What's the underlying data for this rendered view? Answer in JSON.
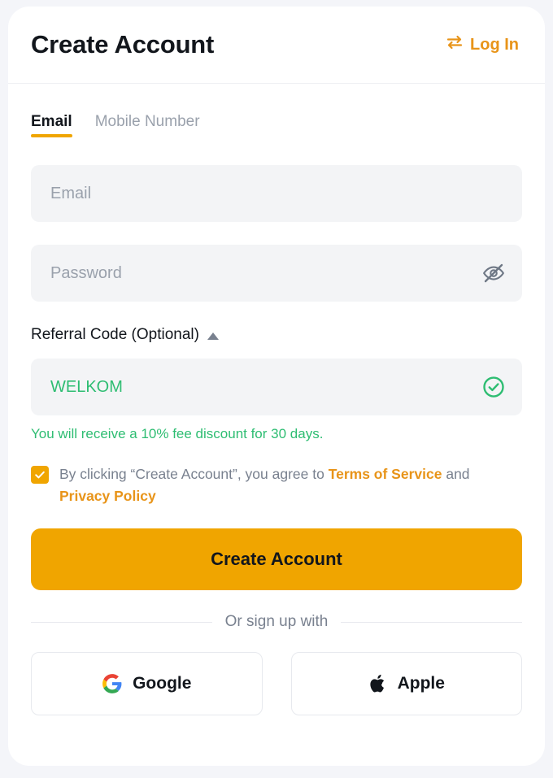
{
  "header": {
    "title": "Create Account",
    "login_label": "Log In",
    "login_icon": "swap-icon",
    "accent_color": "#e89419"
  },
  "tabs": [
    {
      "label": "Email",
      "active": true
    },
    {
      "label": "Mobile Number",
      "active": false
    }
  ],
  "form": {
    "email": {
      "value": "",
      "placeholder": "Email"
    },
    "password": {
      "value": "",
      "placeholder": "Password",
      "toggle_icon": "eye-off-icon"
    },
    "referral": {
      "label": "Referral Code (Optional)",
      "toggle_icon": "caret-up-icon",
      "value": "WELKOM",
      "placeholder": "Referral Code",
      "status_icon": "check-circle-icon",
      "helper_text": "You will receive a 10% fee discount for 30 days.",
      "valid_color": "#2ebd72"
    },
    "terms": {
      "checked": true,
      "prefix": "By clicking “Create Account”, you agree to ",
      "terms_link": "Terms of Service",
      "middle": " and ",
      "privacy_link": "Privacy Policy"
    },
    "submit_label": "Create Account",
    "submit_color": "#f0a500"
  },
  "divider_label": "Or sign up with",
  "social": [
    {
      "label": "Google",
      "icon": "google-icon"
    },
    {
      "label": "Apple",
      "icon": "apple-icon"
    }
  ]
}
